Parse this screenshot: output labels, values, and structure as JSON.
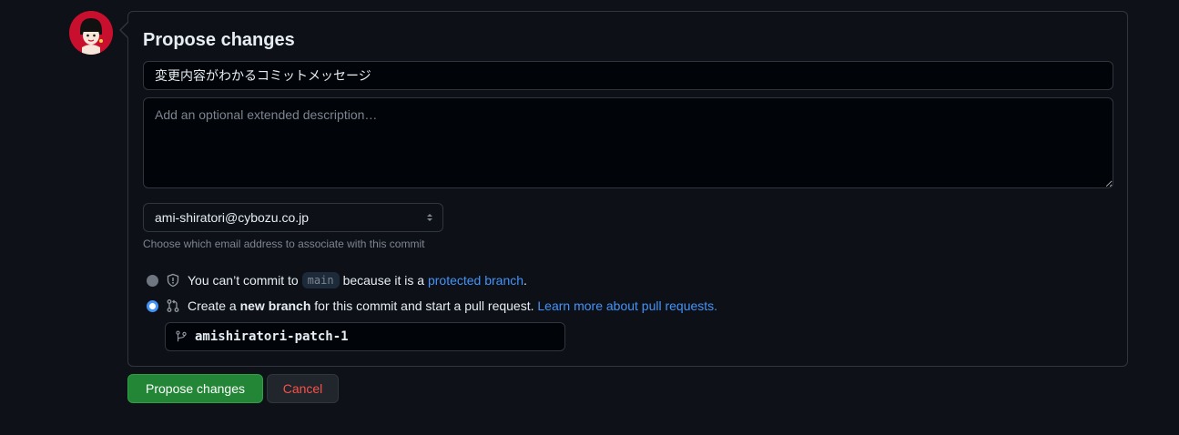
{
  "panel": {
    "title": "Propose changes"
  },
  "commit": {
    "summary_value": "変更内容がわかるコミットメッセージ",
    "description_placeholder": "Add an optional extended description…"
  },
  "email": {
    "selected": "ami-shiratori@cybozu.co.jp",
    "hint": "Choose which email address to associate with this commit"
  },
  "options": {
    "direct": {
      "text_before": "You can’t commit to",
      "branch": "main",
      "text_after": "because it is a",
      "link": "protected branch",
      "period": "."
    },
    "new_branch": {
      "text_before": "Create a",
      "bold": "new branch",
      "text_after": "for this commit and start a pull request.",
      "link": "Learn more about pull requests."
    }
  },
  "branch_name": "amishiratori-patch-1",
  "buttons": {
    "propose": "Propose changes",
    "cancel": "Cancel"
  },
  "colors": {
    "background": "#0e1117",
    "accent_link": "#4493f8",
    "primary_button": "#238636",
    "danger_text": "#f85149",
    "avatar_bg": "#c8102e"
  }
}
